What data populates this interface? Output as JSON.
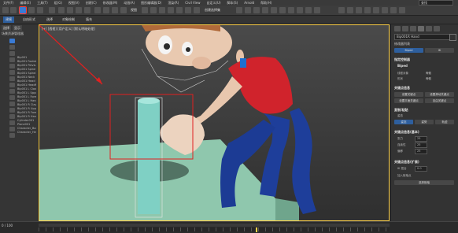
{
  "menubar": {
    "items": [
      "文件(F)",
      "编辑(E)",
      "工具(T)",
      "组(G)",
      "视图(V)",
      "创建(C)",
      "修改器(M)",
      "动画(A)",
      "图形编辑器(D)",
      "渲染(R)",
      "Civil View",
      "自定义(U)",
      "脚本(S)",
      "Arnold",
      "帮助(H)"
    ],
    "search_value": "查找"
  },
  "toolbar": {
    "view_dropdown": "视图",
    "create_selection_set": "创建选择集"
  },
  "ribbon": {
    "tabs": [
      "建模",
      "自由形式",
      "选择",
      "对象绘制",
      "填充"
    ]
  },
  "left_panel": {
    "tabs": [
      "选择",
      "显示"
    ],
    "title": "场景资源管理器",
    "tree_items": [
      "Bip001",
      "Bip001 Footsteps",
      "Bip001 Pelvis",
      "Bip001 Spine",
      "Bip001 Spine1",
      "Bip001 Neck",
      "Bip001 Head",
      "Bip001 HeadNub",
      "Bip001 L Clavicle",
      "Bip001 L UpperArm",
      "Bip001 L Forearm",
      "Bip001 L Hand",
      "Bip001 R Clavicle",
      "Bip001 R UpperArm",
      "Bip001 R Forearm",
      "Bip001 R Hand",
      "Cylinder001",
      "Plane001",
      "Character_Body",
      "Character_Head"
    ]
  },
  "viewport": {
    "label": "[+] [透视] [用户定义] [默认明暗处理]"
  },
  "right_panel": {
    "object_name": "Bip001R Hand",
    "modifier_list": "修改器列表",
    "buttons_top": [
      "Biped",
      "IK"
    ],
    "section_assign": "指定控制器",
    "section_trackbar": "Biped",
    "rows": [
      {
        "label": "线框对象",
        "value": "骨骼"
      },
      {
        "label": "形状",
        "value": "骨骼"
      }
    ],
    "section_key": "关键点信息",
    "key_buttons": [
      "设置关键点",
      "设置滑动关键点",
      "设置平面关键点",
      "自由关键点"
    ],
    "section_ik": "复制/粘贴",
    "ik_label": "姿态",
    "ik_buttons": [
      "姿态",
      "姿势",
      "轨迹"
    ],
    "section_track": "关键点信息(基本)",
    "track_fields": [
      {
        "label": "张力",
        "value": "25"
      },
      {
        "label": "连续性",
        "value": "25"
      },
      {
        "label": "偏移",
        "value": "25"
      }
    ],
    "section_ik_blend": "关键点信息(扩展)",
    "ik_blend_label": "IK 混合",
    "ik_blend_value": "0.0",
    "anchor_label": "加入枢轴点",
    "select_pivot": "选择枢轴"
  },
  "timeline": {
    "frame": "0 / 100"
  }
}
